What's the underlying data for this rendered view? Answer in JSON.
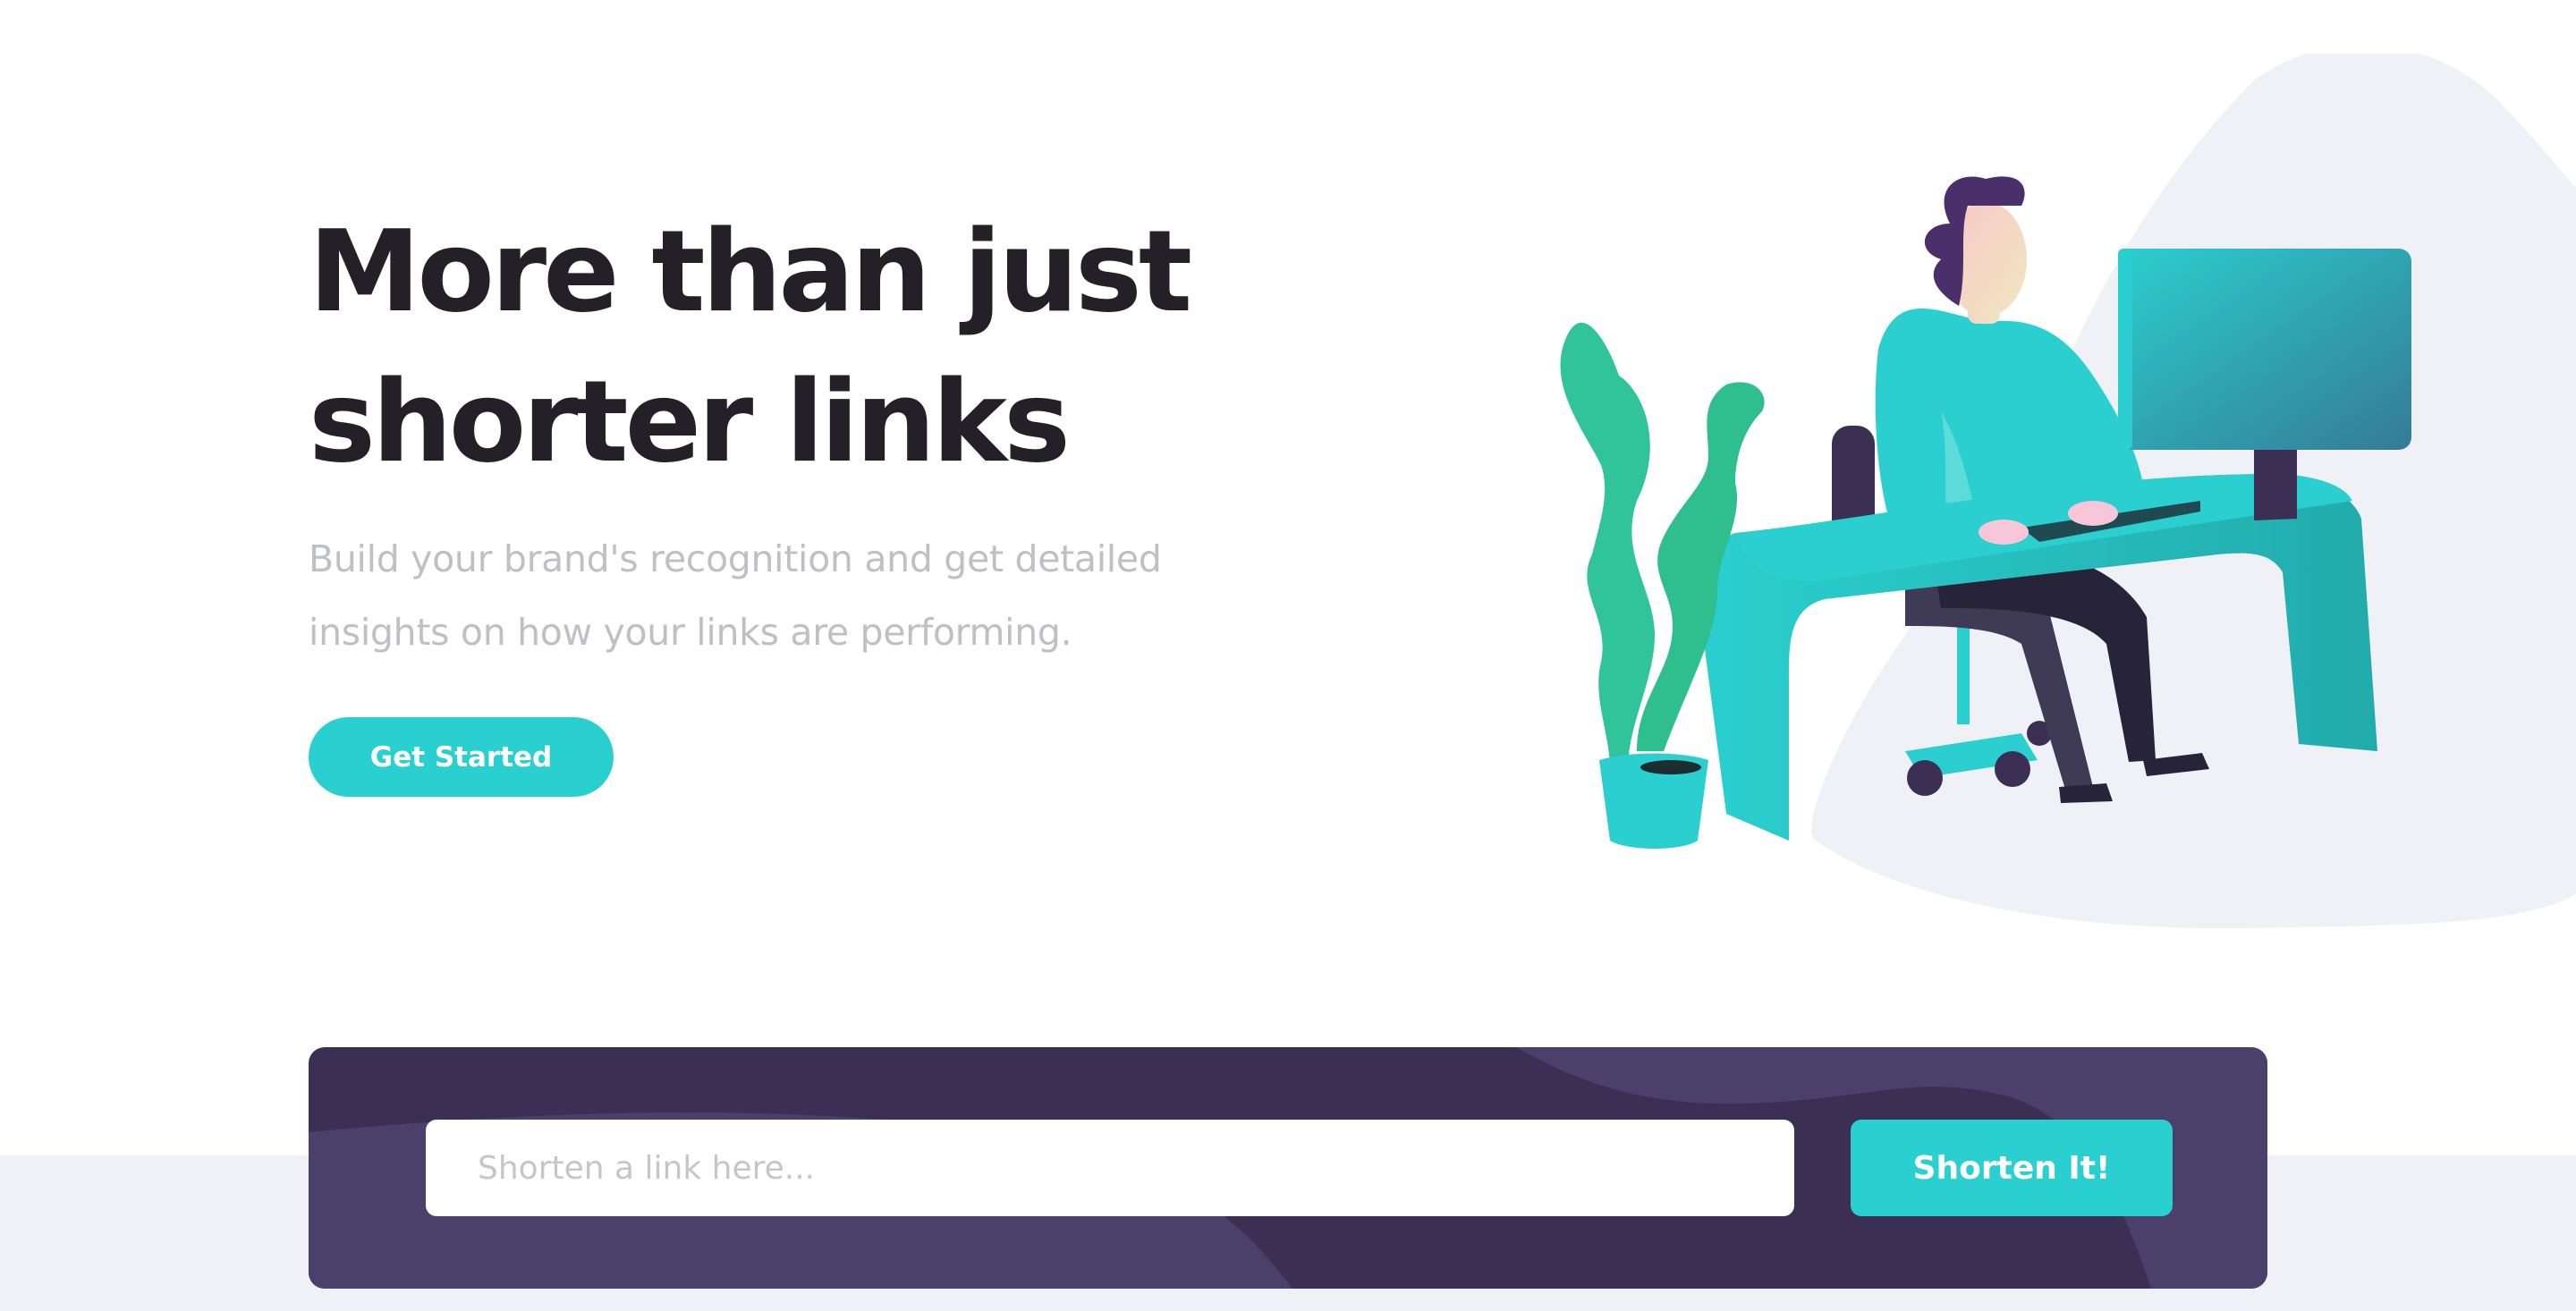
{
  "hero": {
    "title_line1": "More than just",
    "title_line2": "shorter links",
    "subtitle_line1": "Build your brand's recognition and get detailed",
    "subtitle_line2": "insights on how your links are performing.",
    "cta_label": "Get Started"
  },
  "shortener": {
    "input_placeholder": "Shorten a link here...",
    "input_value": "",
    "button_label": "Shorten It!"
  },
  "colors": {
    "accent": "#2acfcf",
    "dark_violet": "#3b3054",
    "very_dark": "#232127",
    "gray_text": "#bfbfc6",
    "light_bg": "#eff1f7"
  },
  "illustration": {
    "icon": "person-working-at-desk-illustration"
  }
}
